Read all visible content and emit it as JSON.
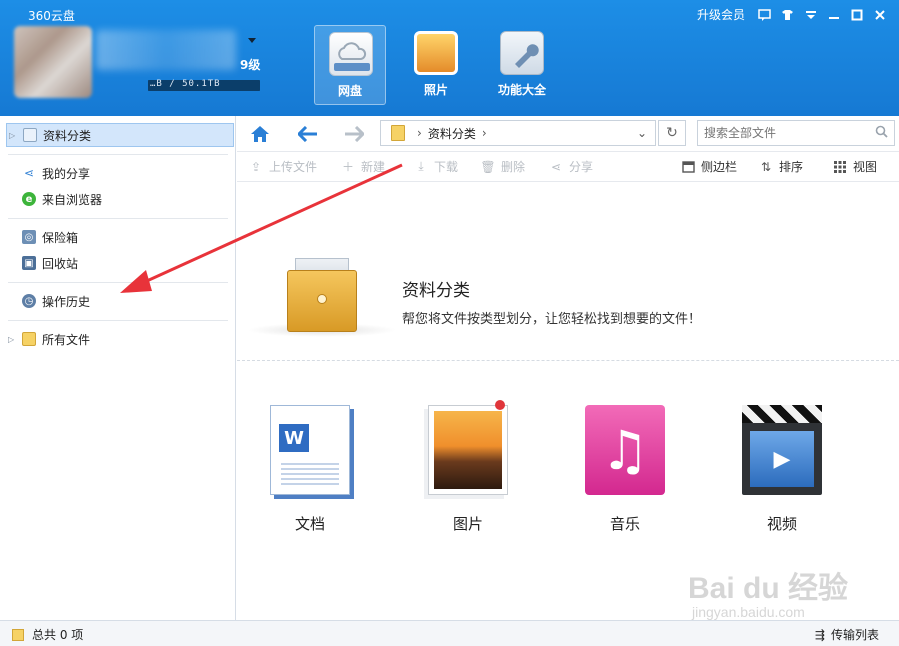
{
  "header": {
    "app_title": "360云盘",
    "vip_level": "9级",
    "storage_text": "…B / 50.1TB",
    "upgrade_label": "升级会员",
    "tabs": [
      {
        "label": "网盘",
        "icon": "cloud-disk-icon",
        "active": true
      },
      {
        "label": "照片",
        "icon": "photo-icon",
        "active": false
      },
      {
        "label": "功能大全",
        "icon": "tools-icon",
        "active": false
      }
    ],
    "window_buttons": [
      "feedback-icon",
      "skin-icon",
      "menu-icon",
      "minimize-icon",
      "maximize-icon",
      "close-icon"
    ]
  },
  "sidebar": {
    "items": [
      {
        "label": "资料分类",
        "icon": "category-icon",
        "selected": true,
        "expandable": true
      },
      {
        "label": "我的分享",
        "icon": "share-icon",
        "selected": false
      },
      {
        "label": "来自浏览器",
        "icon": "browser-icon",
        "selected": false
      },
      {
        "label": "保险箱",
        "icon": "safe-icon",
        "selected": false
      },
      {
        "label": "回收站",
        "icon": "recycle-icon",
        "selected": false
      },
      {
        "label": "操作历史",
        "icon": "history-icon",
        "selected": false
      },
      {
        "label": "所有文件",
        "icon": "folder-icon",
        "selected": false,
        "expandable": true
      }
    ]
  },
  "toolbar": {
    "breadcrumb": "资料分类",
    "search_placeholder": "搜索全部文件",
    "actions": [
      {
        "label": "上传文件",
        "icon": "upload-icon",
        "enabled": false
      },
      {
        "label": "新建",
        "icon": "plus-icon",
        "enabled": false
      },
      {
        "label": "下载",
        "icon": "download-icon",
        "enabled": false
      },
      {
        "label": "删除",
        "icon": "delete-icon",
        "enabled": false
      },
      {
        "label": "分享",
        "icon": "share-icon",
        "enabled": false
      }
    ],
    "view_actions": [
      {
        "label": "侧边栏",
        "icon": "sidebar-icon"
      },
      {
        "label": "排序",
        "icon": "sort-icon"
      },
      {
        "label": "视图",
        "icon": "grid-view-icon"
      }
    ]
  },
  "main": {
    "title": "资料分类",
    "description": "帮您将文件按类型划分，让您轻松找到想要的文件！",
    "categories": [
      {
        "label": "文档",
        "icon": "document-icon"
      },
      {
        "label": "图片",
        "icon": "picture-icon"
      },
      {
        "label": "音乐",
        "icon": "music-icon"
      },
      {
        "label": "视频",
        "icon": "video-icon"
      }
    ]
  },
  "statusbar": {
    "total": "总共 0 项",
    "transfer_label": "传输列表"
  },
  "watermark": {
    "brand": "Bai du 经验",
    "url": "jingyan.baidu.com"
  },
  "colors": {
    "header_blue": "#1a85df",
    "selected_bg": "#d3e6fb",
    "annotation_red": "#e8333a"
  }
}
